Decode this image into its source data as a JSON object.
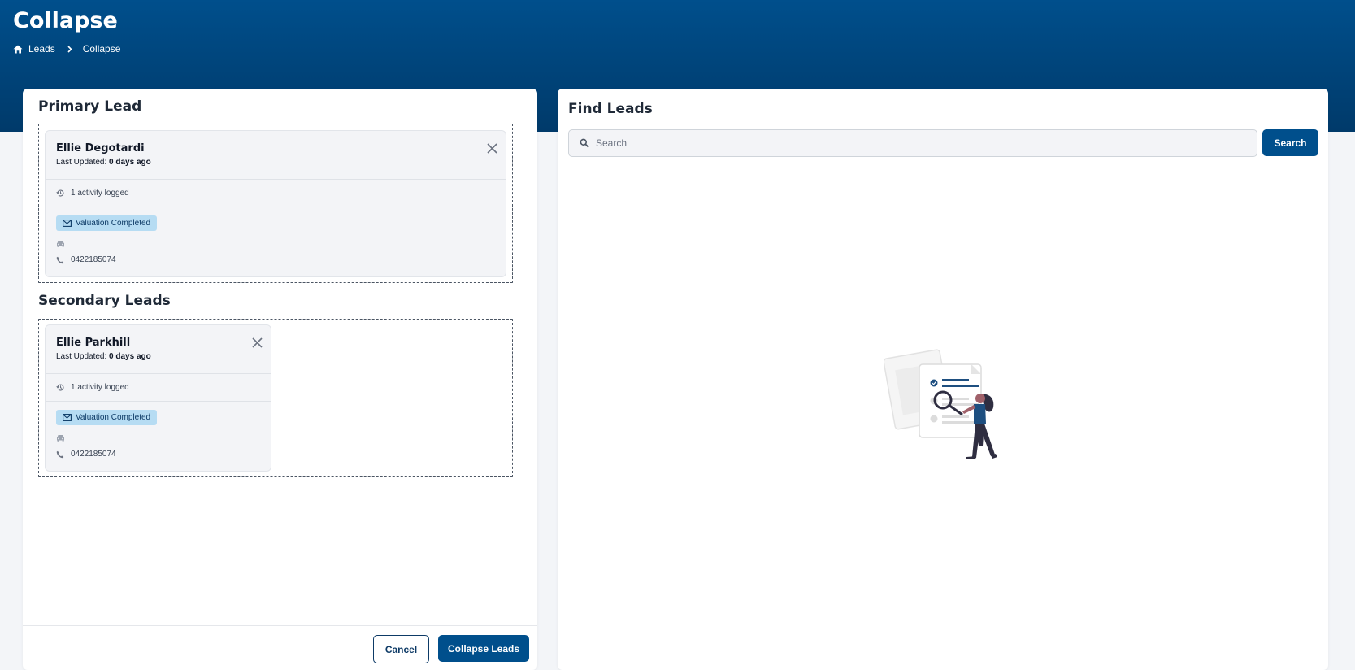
{
  "header": {
    "title": "Collapse",
    "breadcrumb": {
      "home_label": "Leads",
      "current_label": "Collapse"
    }
  },
  "primary": {
    "title": "Primary Lead",
    "card": {
      "name": "Ellie Degotardi",
      "updated_prefix": "Last Updated: ",
      "updated_value": "0 days ago",
      "activity": "1 activity logged",
      "badge": "Valuation Completed",
      "phone": "0422185074"
    }
  },
  "secondary": {
    "title": "Secondary Leads",
    "cards": [
      {
        "name": "Ellie Parkhill",
        "updated_prefix": "Last Updated: ",
        "updated_value": "0 days ago",
        "activity": "1 activity logged",
        "badge": "Valuation Completed",
        "phone": "0422185074"
      }
    ]
  },
  "footer": {
    "cancel_label": "Cancel",
    "collapse_label": "Collapse Leads"
  },
  "find": {
    "title": "Find Leads",
    "search_placeholder": "Search",
    "search_button": "Search"
  },
  "colors": {
    "brand": "#004f8c",
    "badge_bg": "#b6dcf3",
    "accent_figure": "#1e4f80"
  },
  "icons": [
    "home-icon",
    "chevron-right-icon",
    "close-icon",
    "history-icon",
    "mail-icon",
    "car-icon",
    "phone-icon",
    "search-icon"
  ]
}
